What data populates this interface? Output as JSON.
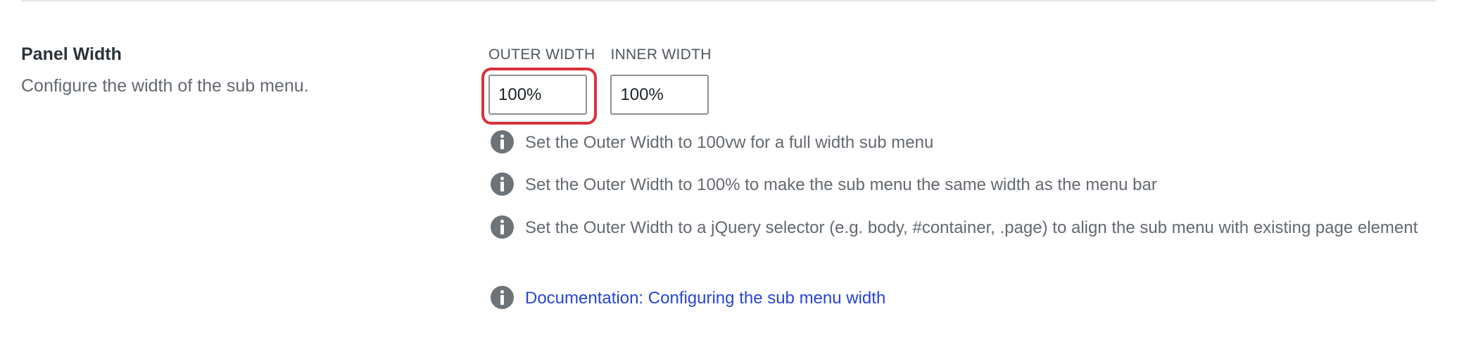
{
  "setting": {
    "title": "Panel Width",
    "description": "Configure the width of the sub menu."
  },
  "fields": {
    "outer": {
      "label": "OUTER WIDTH",
      "value": "100%"
    },
    "inner": {
      "label": "INNER WIDTH",
      "value": "100%"
    }
  },
  "hints": [
    {
      "text": "Set the Outer Width to 100vw for a full width sub menu"
    },
    {
      "text": "Set the Outer Width to 100% to make the sub menu the same width as the menu bar"
    },
    {
      "text": "Set the Outer Width to a jQuery selector (e.g. body, #container, .page) to align the sub menu with existing page element"
    },
    {
      "link": "Documentation: Configuring the sub menu width"
    }
  ],
  "colors": {
    "highlight": "#d9313a",
    "link": "#2745d8",
    "info_icon": "#6e7378"
  },
  "icons": {
    "hint_icon": "info-icon"
  }
}
